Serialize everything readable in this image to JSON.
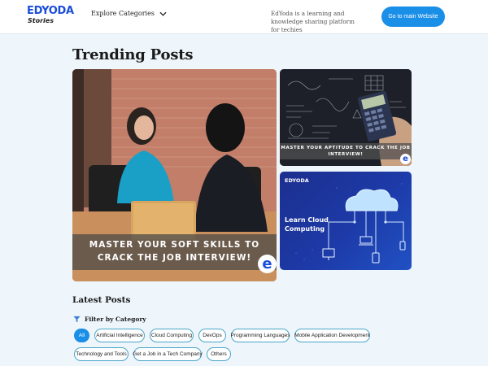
{
  "header": {
    "logo_main": "EDYODA",
    "logo_sub": "Stories",
    "explore_label": "Explore Categories",
    "tagline": "EdYoda is a learning and knowledge sharing platform for techies",
    "main_button": "Go to main Website"
  },
  "trending": {
    "title": "Trending Posts",
    "posts": [
      {
        "banner": "MASTER YOUR SOFT SKILLS TO CRACK THE JOB INTERVIEW!",
        "badge": "e"
      },
      {
        "banner": "MASTER YOUR APTITUDE TO CRACK THE JOB INTERVIEW!",
        "badge": "e"
      },
      {
        "brand": "EDYODA",
        "headline": "Learn Cloud Computing"
      }
    ]
  },
  "latest": {
    "title": "Latest Posts",
    "filter_label": "Filter by Category",
    "categories": [
      "All",
      "Artificial Intelligence",
      "Cloud Computing",
      "DevOps",
      "Programming Languages",
      "Mobile Application Development",
      "Technology and Tools",
      "Get a Job in a Tech Company",
      "Others"
    ],
    "active_category": "All"
  },
  "colors": {
    "brand_blue": "#1a4ed8",
    "button_blue": "#1a8fe8",
    "page_bg": "#eef5fb",
    "chip_border": "#4aa6c9"
  }
}
